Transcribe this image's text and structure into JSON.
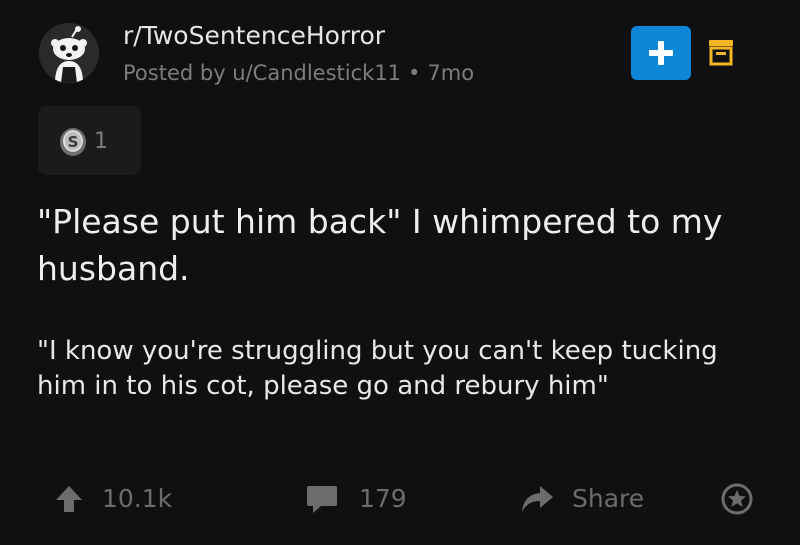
{
  "header": {
    "subreddit": "r/TwoSentenceHorror",
    "posted_by": "Posted by u/Candlestick11",
    "separator": "•",
    "age": "7mo",
    "avatar_icon": "snoo-avatar-icon",
    "join_icon": "plus-icon",
    "save_icon": "archive-icon"
  },
  "award": {
    "icon": "silver-award-icon",
    "count": "1"
  },
  "post": {
    "title": "\"Please put him back\" I whimpered to my husband.",
    "body": "\"I know you're struggling but you can't keep tucking him in to his cot, please go and rebury him\""
  },
  "actions": {
    "upvotes": "10.1k",
    "comments": "179",
    "share": "Share",
    "award_icon": "give-award-icon"
  },
  "colors": {
    "background": "#101012",
    "accent": "#0d86d8",
    "save_icon": "#f5b624",
    "muted": "#6c6c6e"
  }
}
